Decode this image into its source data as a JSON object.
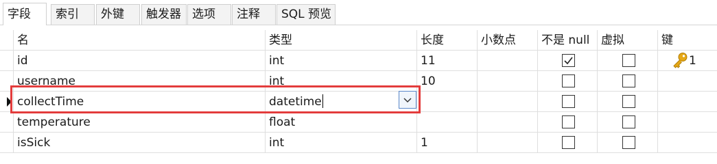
{
  "tabs": [
    "字段",
    "索引",
    "外键",
    "触发器",
    "选项",
    "注释",
    "SQL 预览"
  ],
  "active_tab": "字段",
  "columns": {
    "name": "名",
    "type": "类型",
    "length": "长度",
    "decimals": "小数点",
    "not_null": "不是 null",
    "virtual": "虚拟",
    "key": "键"
  },
  "rows": [
    {
      "name": "id",
      "type": "int",
      "length": "11",
      "decimals": "",
      "not_null": true,
      "virtual": false,
      "key": "1",
      "key_icon": "key-icon"
    },
    {
      "name": "username",
      "type": "int",
      "length": "10",
      "decimals": "",
      "not_null": false,
      "virtual": false,
      "key": ""
    },
    {
      "name": "collectTime",
      "type": "datetime",
      "length": "",
      "decimals": "",
      "not_null": false,
      "virtual": false,
      "key": "",
      "editing": true
    },
    {
      "name": "temperature",
      "type": "float",
      "length": "",
      "decimals": "",
      "not_null": false,
      "virtual": false,
      "key": ""
    },
    {
      "name": "isSick",
      "type": "int",
      "length": "1",
      "decimals": "",
      "not_null": false,
      "virtual": false,
      "key": ""
    }
  ],
  "colors": {
    "highlight_border": "#e33c3c",
    "key_gold": "#e6a817",
    "dropdown_border": "#5a87c9"
  }
}
